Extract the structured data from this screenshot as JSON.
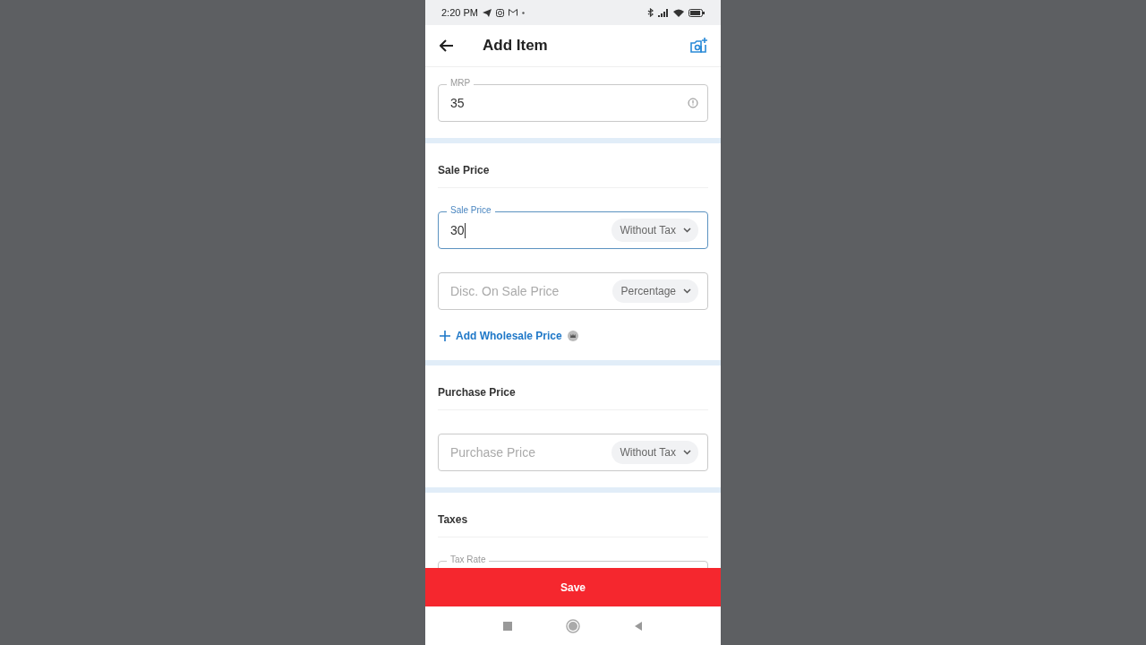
{
  "status_bar": {
    "time": "2:20 PM"
  },
  "header": {
    "title": "Add Item"
  },
  "sections": [
    {
      "fields": [
        {
          "label": "MRP",
          "value": "35",
          "focused": false,
          "info": true
        }
      ]
    },
    {
      "heading": "Sale Price",
      "fields": [
        {
          "label": "Sale Price",
          "value": "30",
          "focused": true,
          "dropdown": "Without Tax"
        },
        {
          "placeholder": "Disc. On Sale Price",
          "focused": false,
          "dropdown": "Percentage"
        }
      ],
      "link": "Add Wholesale Price"
    },
    {
      "heading": "Purchase Price",
      "fields": [
        {
          "placeholder": "Purchase Price",
          "focused": false,
          "dropdown": "Without Tax"
        }
      ]
    },
    {
      "heading": "Taxes",
      "fields": [
        {
          "label": "Tax Rate",
          "focused": false
        }
      ]
    }
  ],
  "save_button": "Save"
}
